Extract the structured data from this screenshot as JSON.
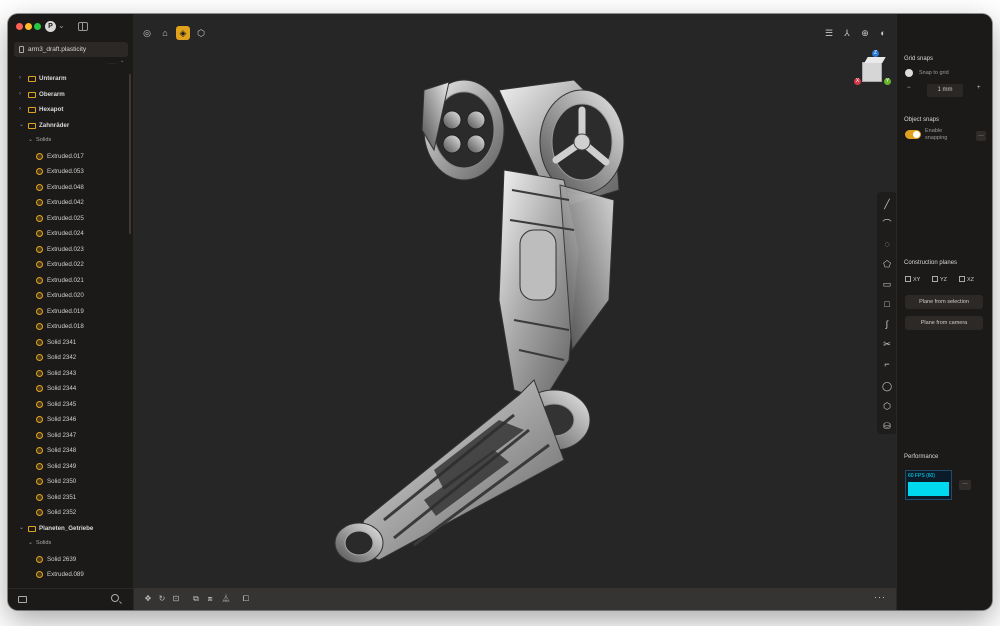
{
  "file": {
    "name": "arm3_draft.plasticity"
  },
  "app": {
    "icon_letter": "P"
  },
  "tree": {
    "groups": [
      {
        "label": "Unterarm",
        "expanded": false
      },
      {
        "label": "Oberarm",
        "expanded": false
      },
      {
        "label": "Hexapot",
        "expanded": false
      }
    ],
    "zahnraeder": {
      "label": "Zahnräder",
      "solids_label": "Solids"
    },
    "zahn_items": [
      "Extruded.017",
      "Extruded.053",
      "Extruded.048",
      "Extruded.042",
      "Extruded.025",
      "Extruded.024",
      "Extruded.023",
      "Extruded.022",
      "Extruded.021",
      "Extruded.020",
      "Extruded.019",
      "Extruded.018",
      "Solid 2341",
      "Solid 2342",
      "Solid 2343",
      "Solid 2344",
      "Solid 2345",
      "Solid 2346",
      "Solid 2347",
      "Solid 2348",
      "Solid 2349",
      "Solid 2350",
      "Solid 2351",
      "Solid 2352"
    ],
    "planeten": {
      "label": "Planeten_Getriebe",
      "solids_label": "Solids"
    },
    "planeten_items": [
      "Solid 2639",
      "Extruded.089"
    ]
  },
  "panel": {
    "grid_snaps_title": "Grid snaps",
    "snap_to_grid": "Snap to grid",
    "grid_value": "1 mm",
    "object_snaps_title": "Object snaps",
    "enable_snapping_1": "Enable",
    "enable_snapping_2": "snapping",
    "construction_title": "Construction planes",
    "planes": [
      "XY",
      "YZ",
      "XZ"
    ],
    "plane_from_selection": "Plane from selection",
    "plane_from_camera": "Plane from camera",
    "performance_title": "Performance",
    "fps": "60 FPS (60)"
  },
  "viewport": {
    "gizmo_z": "Z",
    "gizmo_x": "X",
    "gizmo_y": "Y"
  },
  "colors": {
    "accent": "#e0a21d",
    "folder": "#e1a51c",
    "viewport_bg": "#262626",
    "perf": "#00d8f0"
  }
}
